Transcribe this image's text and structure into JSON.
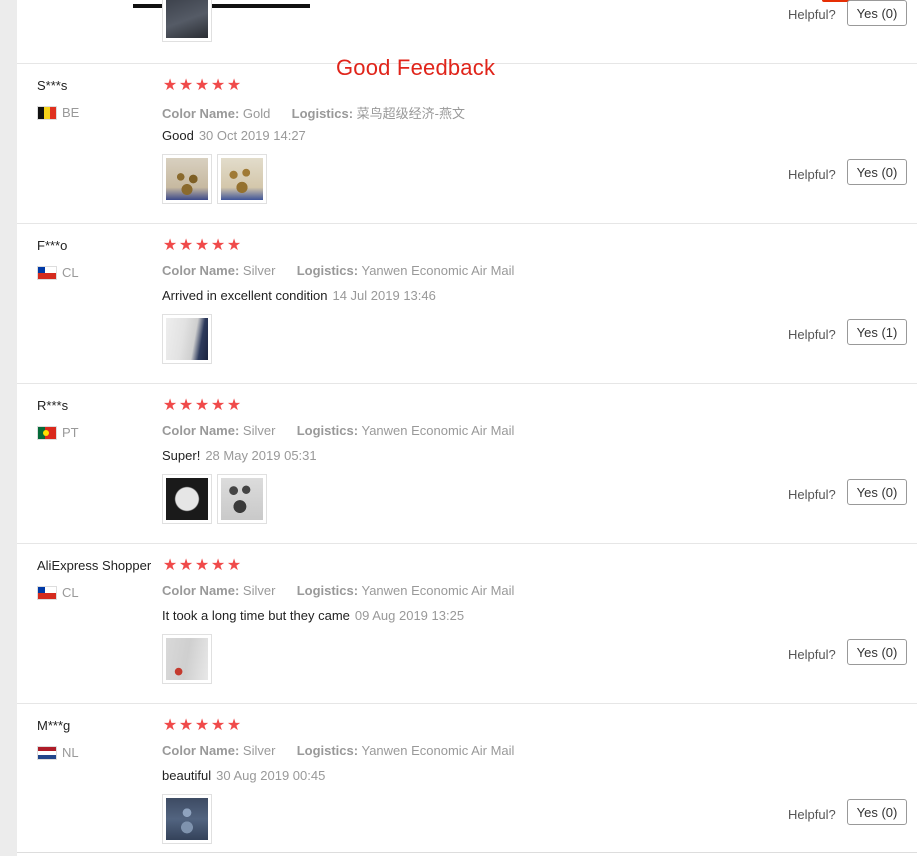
{
  "banner": {
    "title": "Good Feedback"
  },
  "reviews": [
    {
      "user": "",
      "country": "",
      "helpful_label": "Helpful?",
      "yes_label": "Yes (0)"
    },
    {
      "user": "S***s",
      "country": "BE",
      "rating": 5,
      "color_label": "Color Name:",
      "color_value": "Gold",
      "logistics_label": "Logistics:",
      "logistics_value": "菜鸟超级经济-燕文",
      "feedback": "Good",
      "date": "30 Oct 2019 14:27",
      "helpful_label": "Helpful?",
      "yes_label": "Yes (0)"
    },
    {
      "user": "F***o",
      "country": "CL",
      "rating": 5,
      "color_label": "Color Name:",
      "color_value": "Silver",
      "logistics_label": "Logistics:",
      "logistics_value": "Yanwen Economic Air Mail",
      "feedback": "Arrived in excellent condition",
      "date": "14 Jul 2019 13:46",
      "helpful_label": "Helpful?",
      "yes_label": "Yes (1)"
    },
    {
      "user": "R***s",
      "country": "PT",
      "rating": 5,
      "color_label": "Color Name:",
      "color_value": "Silver",
      "logistics_label": "Logistics:",
      "logistics_value": "Yanwen Economic Air Mail",
      "feedback": "Super!",
      "date": "28 May 2019 05:31",
      "helpful_label": "Helpful?",
      "yes_label": "Yes (0)"
    },
    {
      "user": "AliExpress Shopper",
      "country": "CL",
      "rating": 5,
      "color_label": "Color Name:",
      "color_value": "Silver",
      "logistics_label": "Logistics:",
      "logistics_value": "Yanwen Economic Air Mail",
      "feedback": "It took a long time but they came",
      "date": "09 Aug 2019 13:25",
      "helpful_label": "Helpful?",
      "yes_label": "Yes (0)"
    },
    {
      "user": "M***g",
      "country": "NL",
      "rating": 5,
      "color_label": "Color Name:",
      "color_value": "Silver",
      "logistics_label": "Logistics:",
      "logistics_value": "Yanwen Economic Air Mail",
      "feedback": "beautiful",
      "date": "30 Aug 2019 00:45",
      "helpful_label": "Helpful?",
      "yes_label": "Yes (0)"
    }
  ],
  "colors": {
    "star": "#f04a4a",
    "banner": "#e0241a",
    "muted": "#999999"
  },
  "icons": {
    "star": "star-icon",
    "flag": "country-flag-icon"
  }
}
